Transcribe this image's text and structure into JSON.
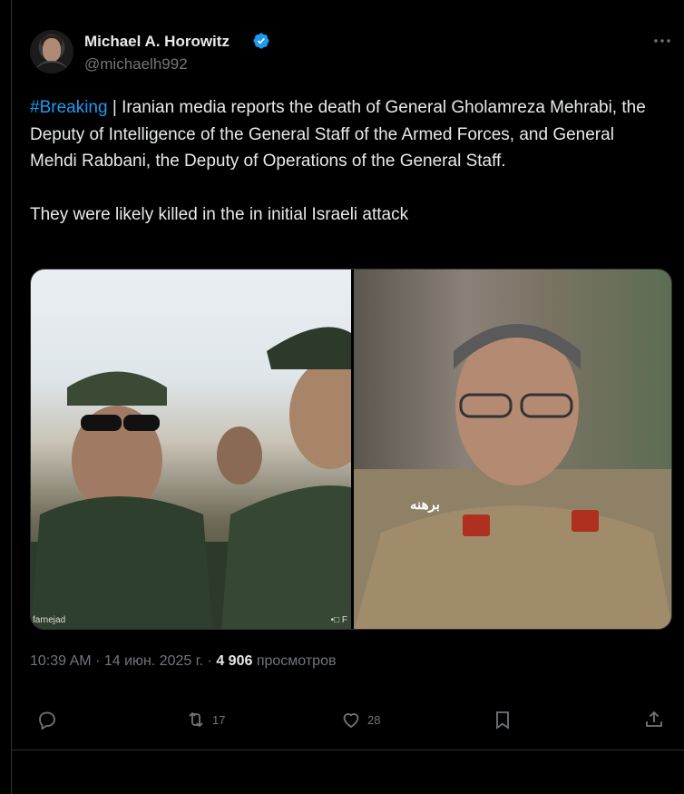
{
  "author": {
    "name": "Michael A. Horowitz",
    "handle": "@michaelh992",
    "verified": true,
    "avatar_icon": "avatar-photo"
  },
  "tweet": {
    "hashtag": "#Breaking",
    "separator": " | ",
    "paragraph1": "Iranian media reports the death of General Gholamreza Mehrabi, the Deputy of Intelligence of the General Staff of the Armed Forces, and General Mehdi Rabbani, the Deputy of Operations of the General Staff.",
    "paragraph2": "They were likely killed in the in initial Israeli attack"
  },
  "media": {
    "left_caption": "farnejad",
    "left_caption_right": "•□ F",
    "right_watermark": "برهنه"
  },
  "meta": {
    "time": "10:39 AM",
    "dot1": " · ",
    "date": "14 июн. 2025 г.",
    "dot2": " · ",
    "views_count": "4 906",
    "views_label": "просмотров"
  },
  "actions": {
    "reply_count": "",
    "retweet_count": "17",
    "like_count": "28"
  },
  "colors": {
    "accent": "#1d9bf0",
    "text": "#e7e9ea",
    "muted": "#71767b",
    "background": "#000000"
  }
}
